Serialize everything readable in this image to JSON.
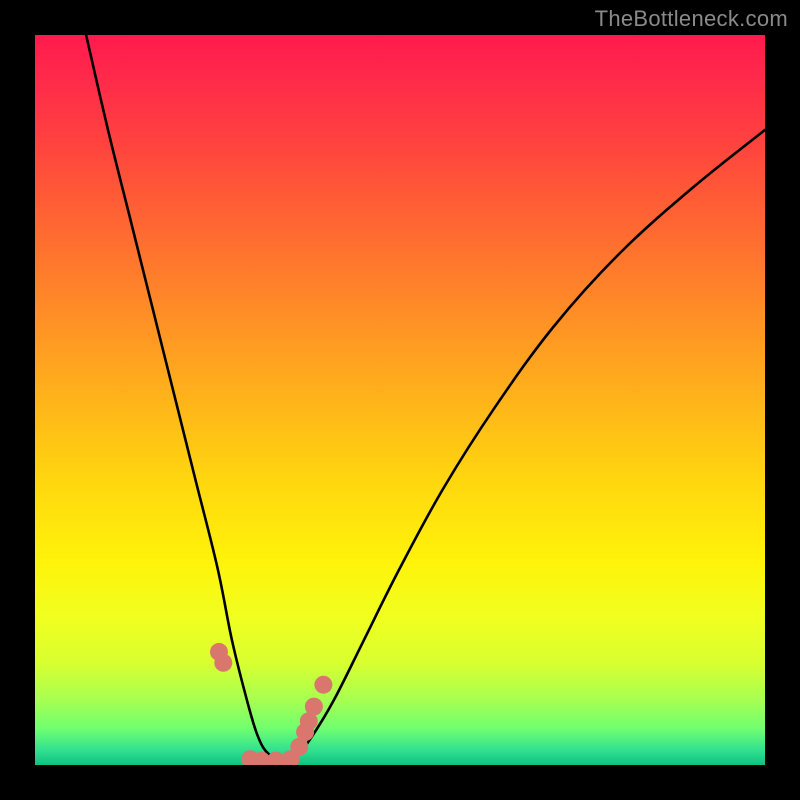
{
  "watermark": "TheBottleneck.com",
  "chart_data": {
    "type": "line",
    "title": "",
    "xlabel": "",
    "ylabel": "",
    "xlim": [
      0,
      100
    ],
    "ylim": [
      0,
      100
    ],
    "series": [
      {
        "name": "bottleneck-curve",
        "color": "#000000",
        "x": [
          7,
          10,
          13,
          16,
          19,
          22,
          25,
          27,
          29,
          30.5,
          32,
          34,
          36,
          38,
          41,
          45,
          50,
          56,
          63,
          71,
          80,
          90,
          100
        ],
        "y": [
          100,
          87,
          75,
          63,
          51,
          39,
          27,
          17,
          9,
          4,
          1.5,
          0.8,
          1.5,
          4,
          9,
          17,
          27,
          38,
          49,
          60,
          70,
          79,
          87
        ]
      },
      {
        "name": "highlight-markers",
        "color": "#d9776f",
        "x": [
          25.2,
          25.8,
          29.5,
          31,
          33,
          35,
          36.2,
          37,
          37.5,
          38.2,
          39.5
        ],
        "y": [
          15.5,
          14,
          0.8,
          0.6,
          0.6,
          0.8,
          2.5,
          4.5,
          6,
          8,
          11
        ]
      }
    ],
    "gradient_stops": [
      {
        "pos": 0,
        "color": "#ff1a4d"
      },
      {
        "pos": 14,
        "color": "#ff4040"
      },
      {
        "pos": 32,
        "color": "#ff7a2c"
      },
      {
        "pos": 52,
        "color": "#ffba18"
      },
      {
        "pos": 72,
        "color": "#fff30a"
      },
      {
        "pos": 91,
        "color": "#a8ff50"
      },
      {
        "pos": 100,
        "color": "#10c080"
      }
    ]
  }
}
